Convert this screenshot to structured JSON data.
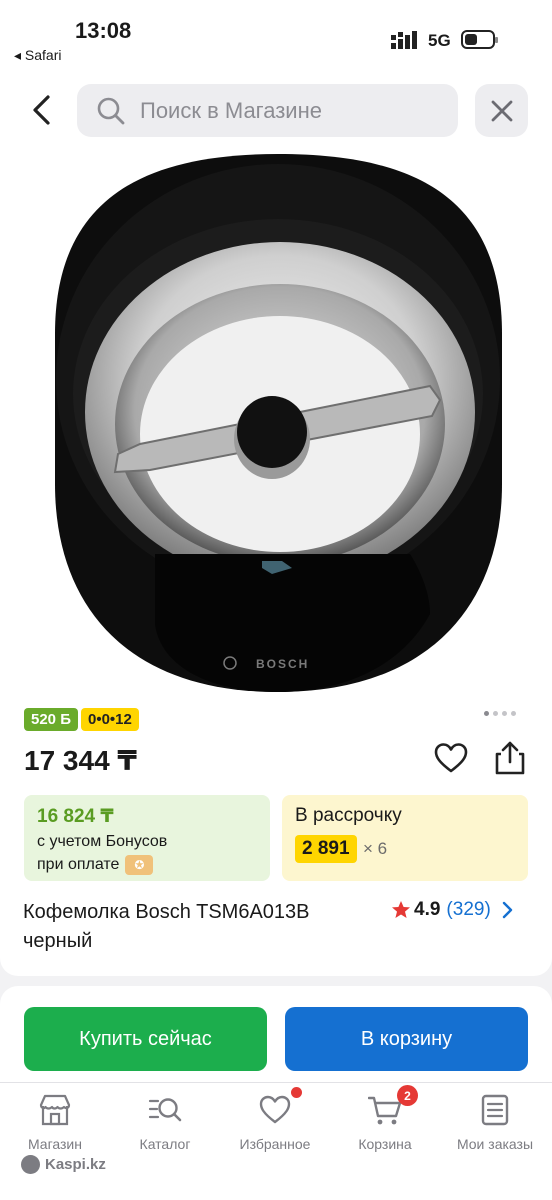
{
  "status": {
    "time": "13:08",
    "back_app": "◂ Safari",
    "network": "5G"
  },
  "search": {
    "placeholder": "Поиск в Магазине"
  },
  "product": {
    "badge_bonus": "520 Б",
    "badge_installment": "0•0•12",
    "price": "17 344 ₸",
    "bonus_price": "16 824 ₸",
    "bonus_line1": "с учетом Бонусов",
    "bonus_line2": "при оплате",
    "installment_title": "В рассрочку",
    "installment_amount": "2 891",
    "installment_months": "× 6",
    "title": "Кофемолка Bosch TSM6A013B черный",
    "rating": "4.9",
    "reviews": "(329)",
    "brand_on_device": "BOSCH"
  },
  "actions": {
    "buy_now": "Купить сейчас",
    "add_to_cart": "В корзину"
  },
  "tabs": [
    {
      "label": "Магазин"
    },
    {
      "label": "Каталог"
    },
    {
      "label": "Избранное"
    },
    {
      "label": "Корзина",
      "badge": "2"
    },
    {
      "label": "Мои заказы"
    }
  ],
  "footer": {
    "brand": "Kaspi.kz"
  },
  "colors": {
    "green": "#1cae4d",
    "blue": "#1570d1",
    "yellow": "#ffd500",
    "bonus_green": "#6aab2b",
    "red": "#e53935"
  }
}
